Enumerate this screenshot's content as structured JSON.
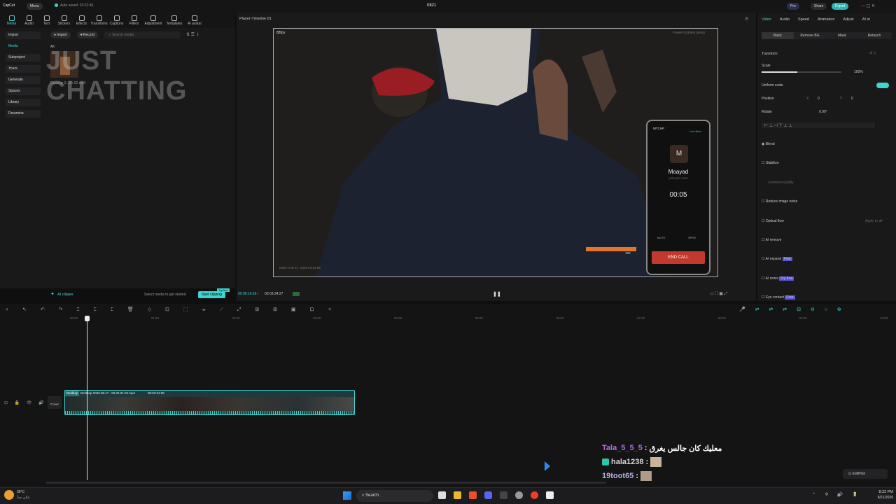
{
  "app": {
    "name": "CapCut",
    "menu": "Menu",
    "autosave": "Auto saved: 20:22:46",
    "project": "0821",
    "pro": "Pro",
    "share": "Share",
    "export": "Export"
  },
  "tools": [
    {
      "label": "Media",
      "icon": "media-icon"
    },
    {
      "label": "Audio",
      "icon": "audio-icon"
    },
    {
      "label": "Text",
      "icon": "text-icon"
    },
    {
      "label": "Stickers",
      "icon": "sticker-icon"
    },
    {
      "label": "Effects",
      "icon": "effects-icon"
    },
    {
      "label": "Transitions",
      "icon": "transitions-icon"
    },
    {
      "label": "Captions",
      "icon": "captions-icon"
    },
    {
      "label": "Filters",
      "icon": "filters-icon"
    },
    {
      "label": "Adjustment",
      "icon": "adjust-icon"
    },
    {
      "label": "Templates",
      "icon": "templates-icon"
    },
    {
      "label": "AI avatar",
      "icon": "avatar-icon"
    }
  ],
  "leftnav": [
    {
      "label": "Import"
    },
    {
      "label": "Media"
    },
    {
      "label": "Subproject"
    },
    {
      "label": "Yours"
    },
    {
      "label": "Generate"
    },
    {
      "label": "Spaces"
    },
    {
      "label": "Library"
    },
    {
      "label": "Dreamina"
    }
  ],
  "media": {
    "import": "Import",
    "record": "Record",
    "search_placeholder": "Search media",
    "filter": "All",
    "file_name": "Desktop 2...01.02.mp4",
    "overlay": "JUST CHATTING"
  },
  "clipper": {
    "label": "AI clipper",
    "hint": "Select media to get started",
    "start": "Start clipping",
    "badge": "Try free"
  },
  "player": {
    "title": "Player-Timeline 01",
    "current": "00:00:16:26",
    "total": "00:03:34:27",
    "fps": "88fps",
    "tag": "FiveM® (b3095) (Beta)",
    "stamp": "MON AUG 17, 2026 03:23:59"
  },
  "phone": {
    "app": "MTCHP",
    "status": "Live Beta",
    "avatar": "M",
    "name": "Moayad",
    "number": "(222) 670-3323",
    "timer": "00:05",
    "end": "END CALL",
    "mute": "MUTE",
    "speak": "SPKR",
    "hud": "100"
  },
  "rightpanel": {
    "tabs": [
      "Video",
      "Audio",
      "Speed",
      "Animation",
      "Adjust",
      "AI st"
    ],
    "subtabs": [
      "Basic",
      "Remove BG",
      "Mask",
      "Retouch"
    ],
    "transform": "Transform",
    "scale": "Scale",
    "scale_value": "100%",
    "scale_level": 0.45,
    "uniform": "Uniform scale",
    "position": "Position",
    "pos_x_label": "X",
    "pos_x": "0",
    "pos_y_label": "Y",
    "pos_y": "0",
    "rotate": "Rotate",
    "rotate_value": "0.00°",
    "blend": "Blend",
    "stabilize": "Stabilize",
    "enhance": "Enhance quality",
    "noise": "Reduce image noise",
    "optical": "Optical flow",
    "apply": "Apply to all",
    "ai_remove": "AI remove",
    "ai_expand": "AI expand",
    "ai_expand_badge": "Free",
    "ai_remix": "AI remix",
    "ai_remix_badge": "Try free",
    "eye": "Eye contact",
    "eye_badge": "Free"
  },
  "timeline": {
    "ticks": [
      "00:00",
      "01:00",
      "02:00",
      "03:00",
      "04:00",
      "05:00",
      "06:00",
      "07:00",
      "08:00",
      "09:00",
      "10:00"
    ],
    "clip_label": "Desktop 2026.08.17 - 06.02.01.02.mp4",
    "clip_duration": "00:03:24:08",
    "clip_short": "Desktop",
    "cover": "Cover",
    "playhead_fraction": 0.045
  },
  "chat": [
    {
      "user": "Tala_5_5_5",
      "text": "معليك كان جالس يغرق",
      "color": "#b66ae8"
    },
    {
      "user": "hala1238",
      "text": "",
      "color": "#d8d8d8"
    },
    {
      "user": "19toot65",
      "text": "",
      "color": "#b8b0e8"
    }
  ],
  "editpilot": "EditPilot",
  "taskbar": {
    "weather_temp": "36°C",
    "weather_desc": "عالي جدأ",
    "search": "Search",
    "time": "8:22 PM",
    "date": "8/21/2026",
    "lang": "ع"
  }
}
